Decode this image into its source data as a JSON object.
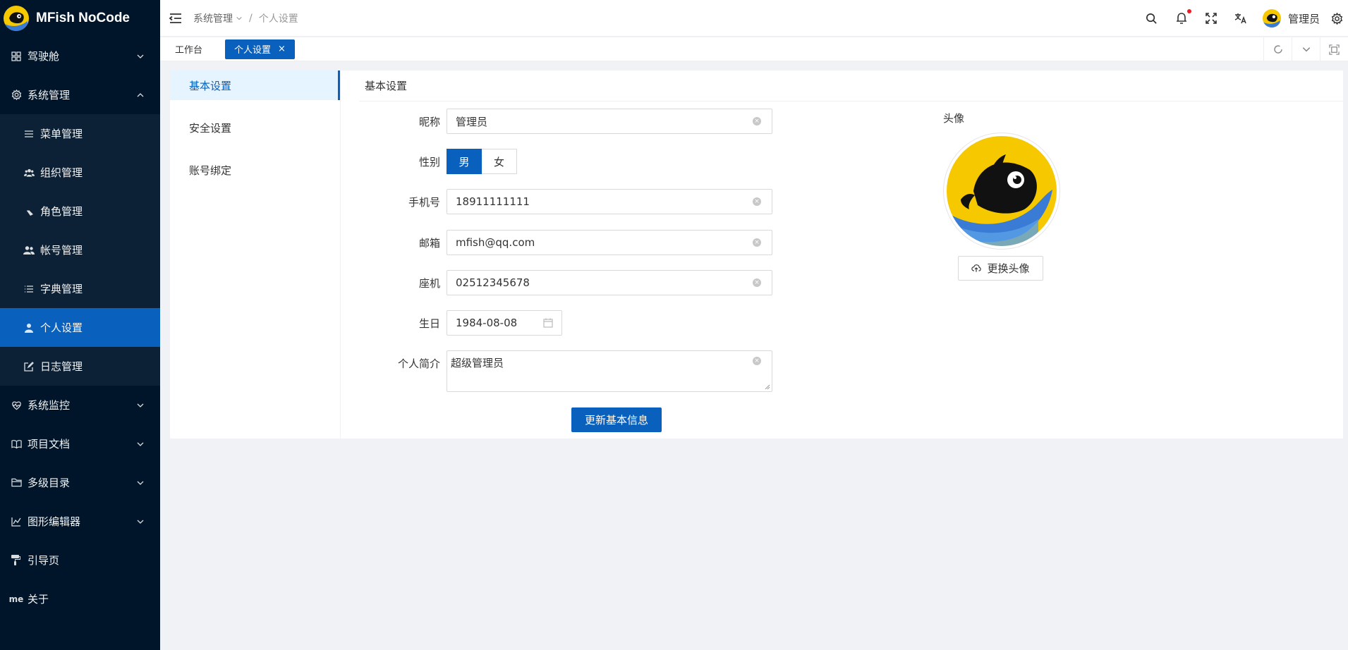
{
  "app": {
    "title": "MFish NoCode"
  },
  "sidebar": {
    "items": [
      {
        "label": "驾驶舱",
        "icon": "dashboard-icon"
      },
      {
        "label": "系统管理",
        "icon": "gear-icon"
      },
      {
        "label": "系统监控",
        "icon": "heart-monitor-icon"
      },
      {
        "label": "项目文档",
        "icon": "book-icon"
      },
      {
        "label": "多级目录",
        "icon": "folder-icon"
      },
      {
        "label": "图形编辑器",
        "icon": "chart-icon"
      },
      {
        "label": "引导页",
        "icon": "paint-roller-icon"
      },
      {
        "label": "关于",
        "icon": "me-icon",
        "icon_text": "me"
      }
    ],
    "sub_items": [
      {
        "label": "菜单管理",
        "icon": "menu-lines-icon"
      },
      {
        "label": "组织管理",
        "icon": "team-icon"
      },
      {
        "label": "角色管理",
        "icon": "role-icon"
      },
      {
        "label": "帐号管理",
        "icon": "users-icon"
      },
      {
        "label": "字典管理",
        "icon": "list-icon"
      },
      {
        "label": "个人设置",
        "icon": "user-icon"
      },
      {
        "label": "日志管理",
        "icon": "edit-log-icon"
      }
    ]
  },
  "header": {
    "breadcrumb": [
      "系统管理",
      "个人设置"
    ],
    "breadcrumb_sep": "/",
    "username": "管理员",
    "notification_dot_color": "#ed1c24"
  },
  "tabs": [
    {
      "label": "工作台",
      "active": false
    },
    {
      "label": "个人设置",
      "active": true,
      "close": "×"
    }
  ],
  "settings_menu": [
    "基本设置",
    "安全设置",
    "账号绑定"
  ],
  "panel": {
    "title": "基本设置"
  },
  "form": {
    "nickname": {
      "label": "昵称",
      "value": "管理员"
    },
    "gender": {
      "label": "性别",
      "options": [
        "男",
        "女"
      ],
      "selected": "男"
    },
    "phone": {
      "label": "手机号",
      "value": "18911111111"
    },
    "email": {
      "label": "邮箱",
      "value": "mfish@qq.com"
    },
    "landline": {
      "label": "座机",
      "value": "02512345678"
    },
    "birthday": {
      "label": "生日",
      "value": "1984-08-08"
    },
    "bio": {
      "label": "个人简介",
      "value": "超级管理员"
    },
    "submit_label": "更新基本信息"
  },
  "avatar": {
    "title": "头像",
    "upload_label": "更换头像"
  },
  "colors": {
    "primary": "#0960bd",
    "sidebar_bg": "#001529",
    "logo_yellow": "#f5c800"
  }
}
